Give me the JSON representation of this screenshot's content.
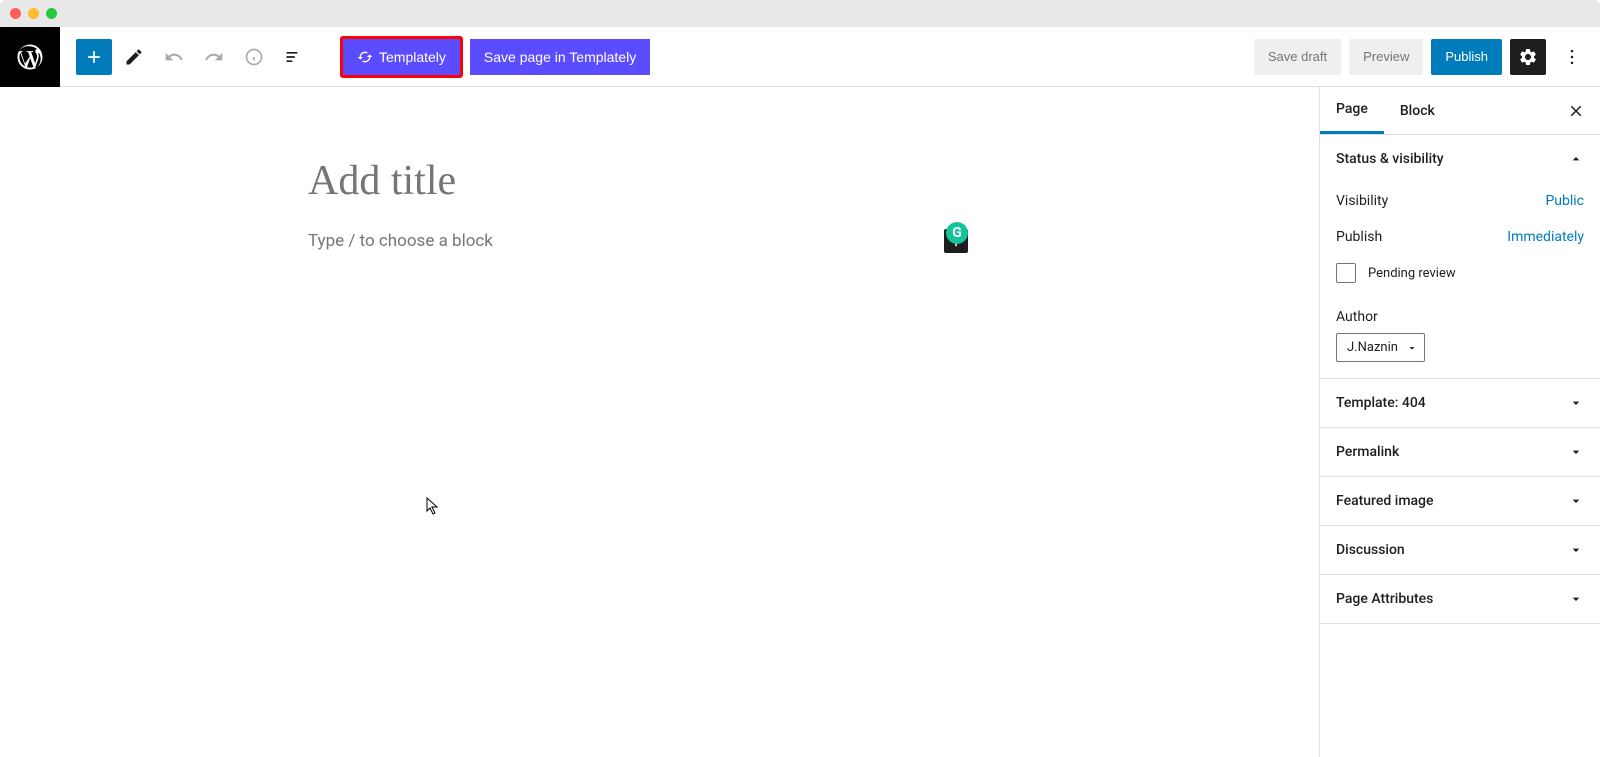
{
  "toolbar": {
    "templately_label": "Templately",
    "save_templately_label": "Save page in Templately",
    "save_draft_label": "Save draft",
    "preview_label": "Preview",
    "publish_label": "Publish"
  },
  "editor": {
    "title_placeholder": "Add title",
    "block_placeholder": "Type / to choose a block"
  },
  "grammarly": {
    "letter": "G"
  },
  "sidebar": {
    "tabs": {
      "page": "Page",
      "block": "Block"
    },
    "panels": {
      "status": {
        "title": "Status & visibility",
        "visibility_label": "Visibility",
        "visibility_value": "Public",
        "publish_label": "Publish",
        "publish_value": "Immediately",
        "pending_label": "Pending review",
        "author_label": "Author",
        "author_value": "J.Naznin"
      },
      "template": "Template: 404",
      "permalink": "Permalink",
      "featured_image": "Featured image",
      "discussion": "Discussion",
      "page_attributes": "Page Attributes"
    }
  }
}
